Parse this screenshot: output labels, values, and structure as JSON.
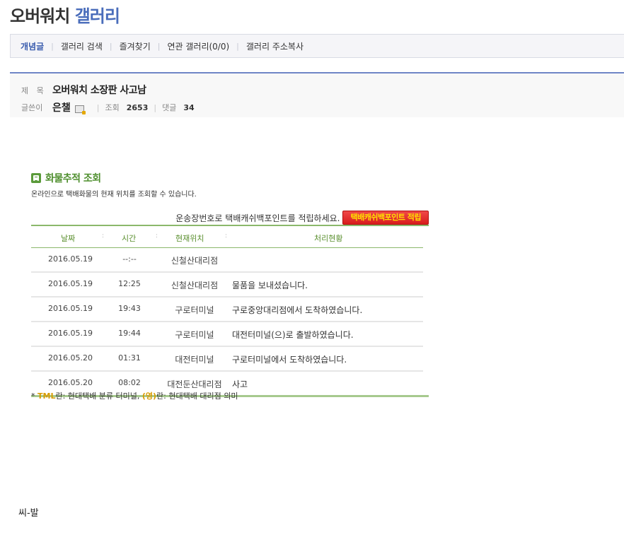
{
  "gallery": {
    "title_main": "오버워치",
    "title_accent": "갤러리"
  },
  "tabs": [
    {
      "label": "개념글"
    },
    {
      "label": "갤러리 검색"
    },
    {
      "label": "즐겨찾기"
    },
    {
      "label": "연관 갤러리(0/0)"
    },
    {
      "label": "갤러리 주소복사"
    }
  ],
  "post": {
    "title_label": "제 목",
    "title": "오버워치 소장판 사고남",
    "author_label": "글쓴이",
    "author": "은챌",
    "views_label": "조회",
    "views": "2653",
    "comments_label": "댓글",
    "comments": "34"
  },
  "tracking": {
    "title": "화물추적 조회",
    "description": "온라인으로 택배화물의 현재 위치를 조회할 수 있습니다.",
    "promo_text": "운송장번호로 택배캐쉬백포인트를 적립하세요.",
    "promo_button": "택배캐쉬백포인트 적립",
    "columns": [
      "날짜",
      "시간",
      "현재위치",
      "처리현황"
    ],
    "rows": [
      {
        "date": "2016.05.19",
        "time": "--:--",
        "location": "신철산대리점",
        "status": ""
      },
      {
        "date": "2016.05.19",
        "time": "12:25",
        "location": "신철산대리점",
        "status": "물품을 보내셨습니다."
      },
      {
        "date": "2016.05.19",
        "time": "19:43",
        "location": "구로터미널",
        "status": "구로중앙대리점에서 도착하였습니다."
      },
      {
        "date": "2016.05.19",
        "time": "19:44",
        "location": "구로터미널",
        "status": "대전터미널(으)로 출발하였습니다."
      },
      {
        "date": "2016.05.20",
        "time": "01:31",
        "location": "대전터미널",
        "status": "구로터미널에서 도착하였습니다."
      },
      {
        "date": "2016.05.20",
        "time": "08:02",
        "location": "대전둔산대리점",
        "status": "사고"
      }
    ],
    "footnote_prefix": "* ",
    "footnote_tml": "TML",
    "footnote_mid": "란: 현대택배 분류 터미널, ",
    "footnote_young": "(영)",
    "footnote_end": "란: 현대택배 대리점 의미"
  },
  "body_text": "씨-발",
  "colors": {
    "accent_blue": "#4a6dbb",
    "tracking_green": "#4f8f2e",
    "promo_red": "#e02a2a",
    "promo_yellow": "#ffe000"
  }
}
